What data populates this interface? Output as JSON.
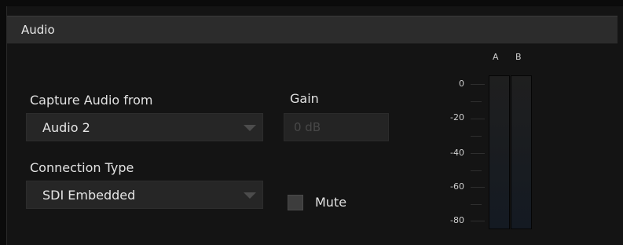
{
  "panel": {
    "title": "Audio"
  },
  "capture": {
    "label": "Capture Audio from",
    "selected": "Audio 2"
  },
  "connection": {
    "label": "Connection Type",
    "selected": "SDI Embedded"
  },
  "gain": {
    "label": "Gain",
    "value": "0 dB"
  },
  "mute": {
    "label": "Mute",
    "checked": false
  },
  "meter": {
    "channels": [
      "A",
      "B"
    ],
    "scale": [
      "0",
      "-20",
      "-40",
      "-60",
      "-80"
    ]
  }
}
